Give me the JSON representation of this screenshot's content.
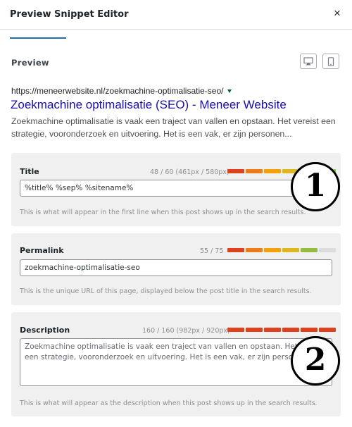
{
  "header": {
    "title": "Preview Snippet Editor",
    "close_icon": "×"
  },
  "preview": {
    "label": "Preview",
    "url": "https://meneerwebsite.nl/zoekmachine-optimalisatie-seo/",
    "title": "Zoekmachine optimalisatie (SEO) - Meneer Website",
    "description": "Zoekmachine optimalisatie is vaak een traject van vallen en opstaan. Het vereist een strategie, vooronderzoek en uitvoering. Het is een vak, er zijn personen..."
  },
  "title_field": {
    "label": "Title",
    "counter": "48 / 60 (461px / 580px)",
    "value": "%title% %sep% %sitename%",
    "help": "This is what will appear in the first line when this post shows up in the search results.",
    "meter": [
      "#e2401c",
      "#ee7c1b",
      "#f6a10a",
      "#dcb81b",
      "#93bd3e",
      "#7ad03a"
    ]
  },
  "permalink_field": {
    "label": "Permalink",
    "counter": "55 / 75",
    "value": "zoekmachine-optimalisatie-seo",
    "help": "This is the unique URL of this page, displayed below the post title in the search results.",
    "meter": [
      "#e2401c",
      "#ee7c1b",
      "#f6a10a",
      "#dcb81b",
      "#93bd3e",
      "#dcdcde"
    ]
  },
  "description_field": {
    "label": "Description",
    "counter": "160 / 160 (982px / 920px)",
    "value": "Zoekmachine optimalisatie is vaak een traject van vallen en opstaan. Het vereist een strategie, vooronderzoek en uitvoering. Het is een vak, er zijn personen...",
    "help": "This is what will appear as the description when this post shows up in the search results.",
    "meter": [
      "#e2401c",
      "#e2401c",
      "#e2401c",
      "#e2401c",
      "#e2401c",
      "#e2401c"
    ]
  },
  "callouts": {
    "one": "1",
    "two": "2"
  },
  "colors": {
    "accent": "#2271b1",
    "link": "#1a0dab",
    "url_green": "#006621"
  },
  "icons": {
    "desktop": "desktop-icon",
    "mobile": "mobile-icon"
  }
}
